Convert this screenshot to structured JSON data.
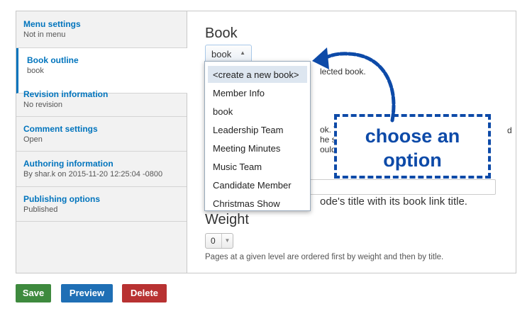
{
  "sidebar": {
    "tabs": [
      {
        "title": "Menu settings",
        "summary": "Not in menu"
      },
      {
        "title": "Book outline",
        "summary": "book"
      },
      {
        "title": "Revision information",
        "summary": "No revision"
      },
      {
        "title": "Comment settings",
        "summary": "Open"
      },
      {
        "title": "Authoring information",
        "summary": "By shar.k on 2015-11-20 12:25:04 -0800"
      },
      {
        "title": "Publishing options",
        "summary": "Published"
      }
    ]
  },
  "book": {
    "label": "Book",
    "selected": "book",
    "options": [
      "<create a new book>",
      "Member Info",
      "book",
      "Leadership Team",
      "Meeting Minutes",
      "Music Team",
      "Candidate Member",
      "Christmas Show"
    ],
    "partial_text_1": "lected book.",
    "partial_text_2": "ok. The",
    "partial_text_3": "he se",
    "partial_text_4": "ould",
    "partial_text_5": "d",
    "partial_text_6": "ode's title with its book link title."
  },
  "weight": {
    "label": "Weight",
    "value": "0",
    "description": "Pages at a given level are ordered first by weight and then by title."
  },
  "actions": {
    "save": "Save",
    "preview": "Preview",
    "delete": "Delete"
  },
  "annotation": {
    "line1": "choose an",
    "line2": "option"
  },
  "colors": {
    "save": "#3e8a3e",
    "preview": "#1f6fb5",
    "delete": "#b83232",
    "annotation": "#0d4aa8",
    "link": "#0074bd"
  }
}
